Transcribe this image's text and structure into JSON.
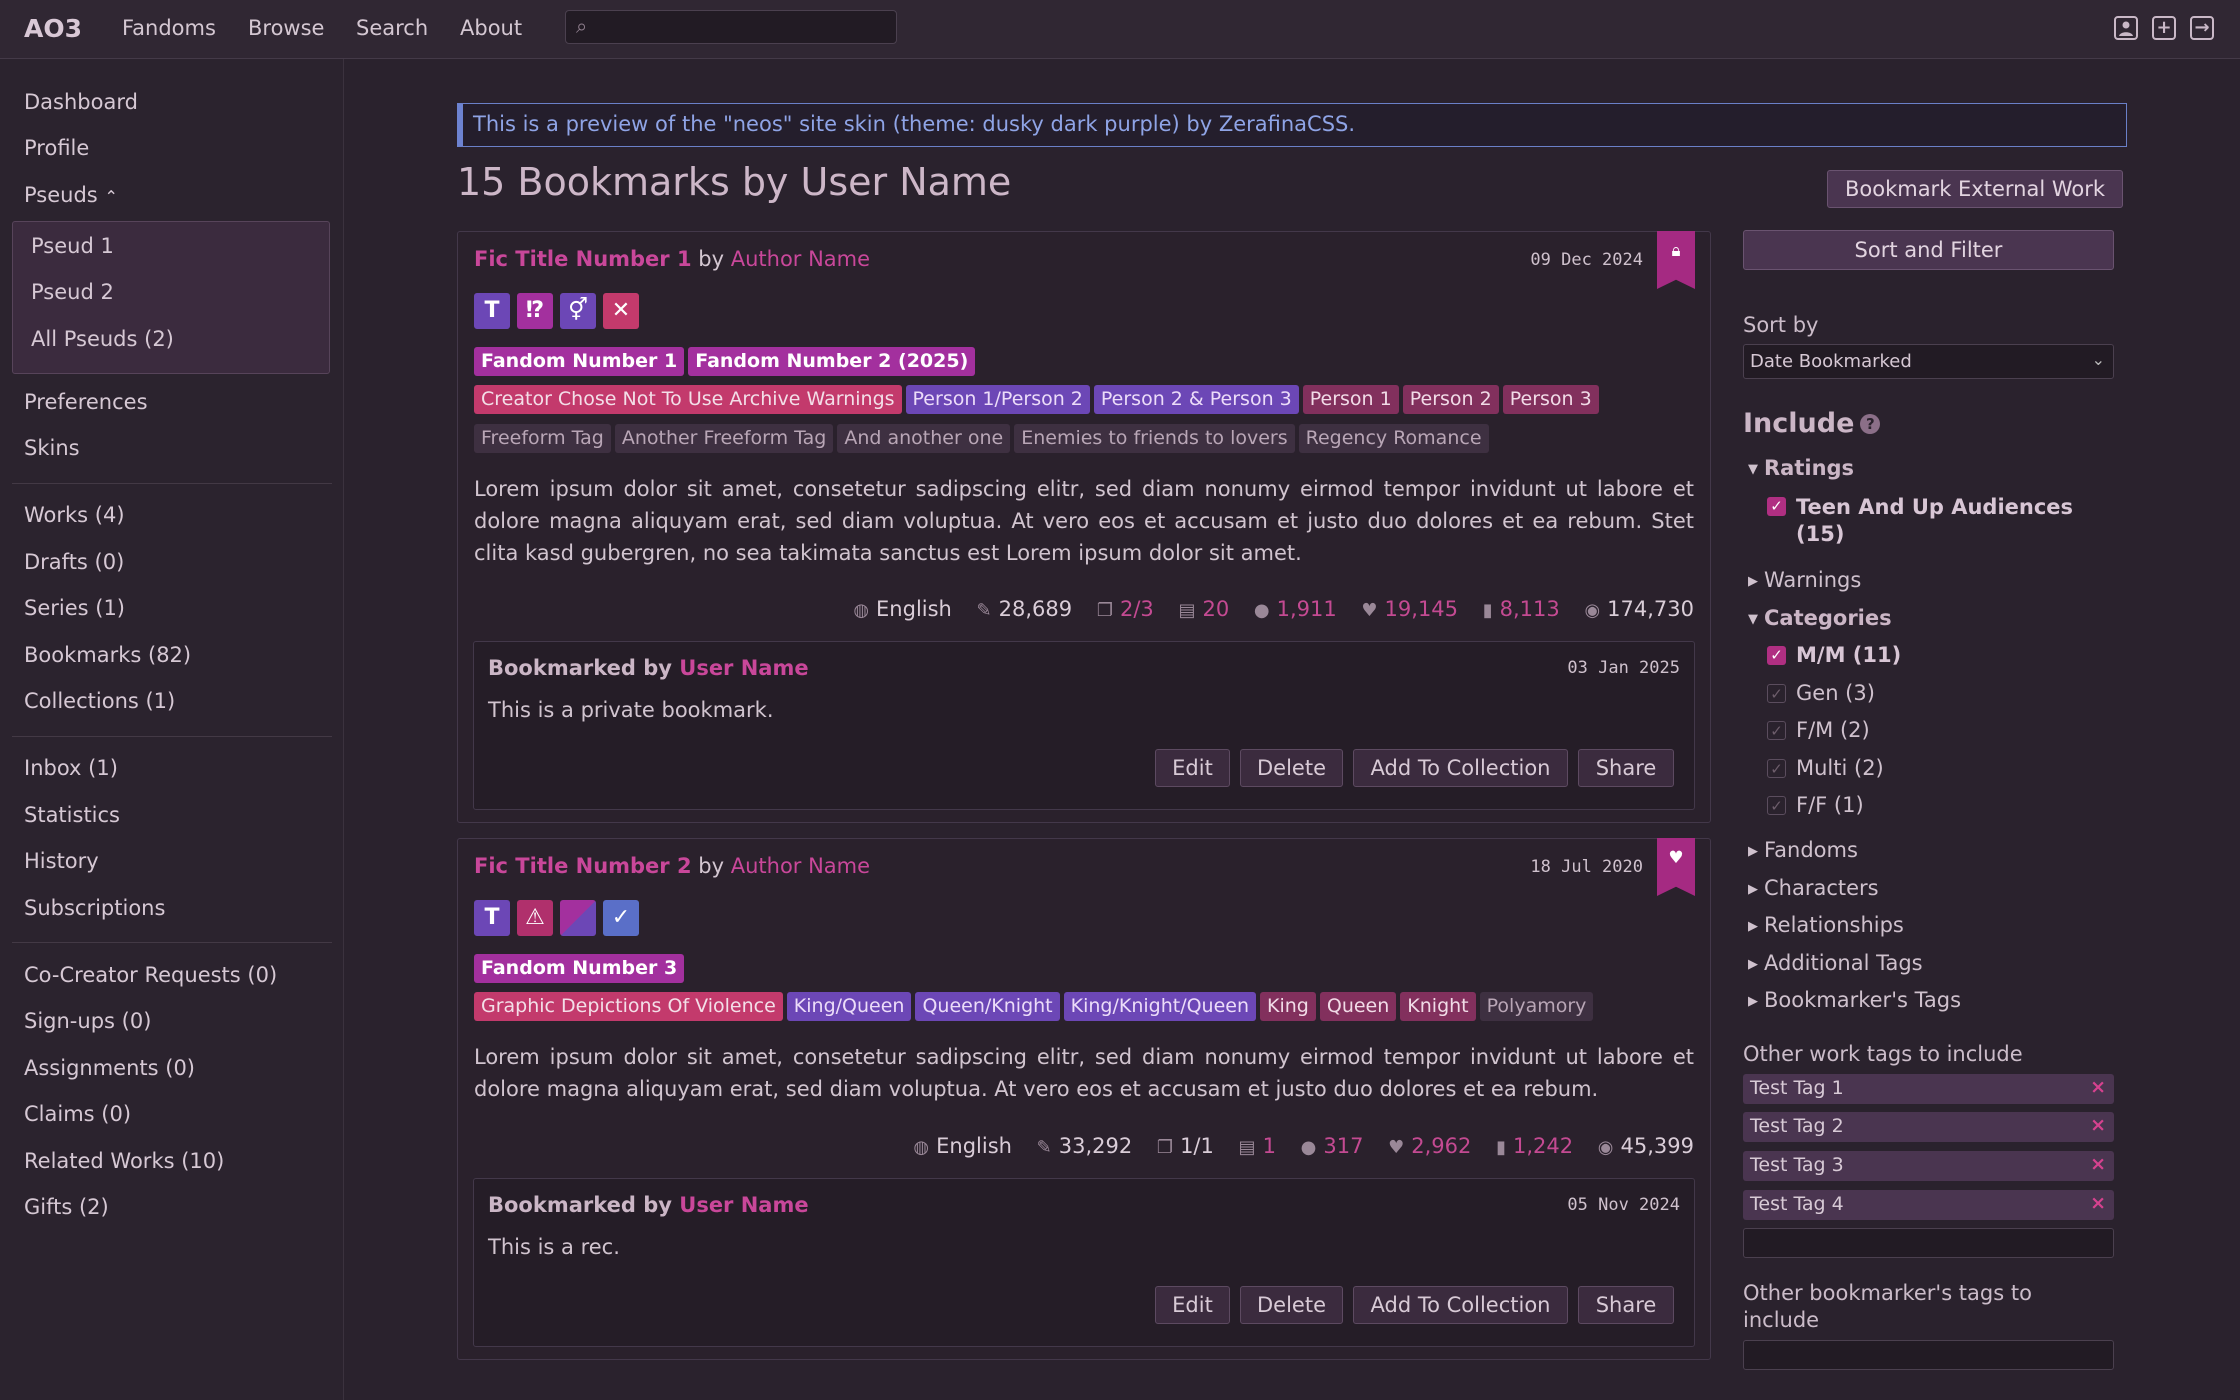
{
  "topbar": {
    "logo": "AO3",
    "nav": [
      "Fandoms",
      "Browse",
      "Search",
      "About"
    ],
    "search_value": "",
    "icons": [
      "user-icon",
      "add-icon",
      "logout-icon"
    ]
  },
  "sidebar": {
    "items": [
      "Dashboard",
      "Profile"
    ],
    "pseuds_label": "Pseuds",
    "pseuds": [
      "Pseud 1",
      "Pseud 2",
      "All Pseuds (2)"
    ],
    "items2": [
      "Preferences",
      "Skins"
    ],
    "items3": [
      "Works (4)",
      "Drafts (0)",
      "Series (1)",
      "Bookmarks (82)",
      "Collections (1)"
    ],
    "items4": [
      "Inbox (1)",
      "Statistics",
      "History",
      "Subscriptions"
    ],
    "items5": [
      "Co-Creator Requests (0)",
      "Sign-ups (0)",
      "Assignments (0)",
      "Claims (0)",
      "Related Works (10)",
      "Gifts (2)"
    ]
  },
  "banner": "This is a preview of the \"neos\" site skin (theme: dusky dark purple) by ZerafinaCSS.",
  "page_title": "15 Bookmarks by User Name",
  "bookmark_external": "Bookmark External Work",
  "works": [
    {
      "title": "Fic Title Number 1",
      "by": "by",
      "author": "Author Name",
      "date": "09 Dec 2024",
      "ribbon_icon": "lock-icon",
      "squares": [
        "T",
        "⁉",
        "⚥",
        "✕"
      ],
      "fandoms": [
        "Fandom Number 1",
        "Fandom Number 2 (2025)"
      ],
      "warnings": [
        "Creator Chose Not To Use Archive Warnings"
      ],
      "relationships": [
        "Person 1/Person 2",
        "Person 2 & Person 3"
      ],
      "characters": [
        "Person 1",
        "Person 2",
        "Person 3"
      ],
      "freeforms": [
        "Freeform Tag",
        "Another Freeform Tag",
        "And another one",
        "Enemies to friends to lovers",
        "Regency Romance"
      ],
      "summary": "Lorem ipsum dolor sit amet, consetetur sadipscing elitr, sed diam nonumy eirmod tempor invidunt ut labore et dolore magna aliquyam erat, sed diam voluptua. At vero eos et accusam et justo duo dolores et ea rebum. Stet clita kasd gubergren, no sea takimata sanctus est Lorem ipsum dolor sit amet.",
      "stats": {
        "language": "English",
        "words": "28,689",
        "chapters": "2/3",
        "collections": "20",
        "comments": "1,911",
        "kudos": "19,145",
        "bookmarks": "8,113",
        "hits": "174,730"
      },
      "bookmark": {
        "label": "Bookmarked by",
        "user": "User Name",
        "date": "03 Jan 2025",
        "note": "This is a private bookmark."
      }
    },
    {
      "title": "Fic Title Number 2",
      "by": "by",
      "author": "Author Name",
      "date": "18 Jul 2020",
      "ribbon_icon": "heart-icon",
      "squares": [
        "T",
        "⚠",
        "",
        "✓"
      ],
      "fandoms": [
        "Fandom Number 3"
      ],
      "warnings": [
        "Graphic Depictions Of Violence"
      ],
      "relationships": [
        "King/Queen",
        "Queen/Knight",
        "King/Knight/Queen"
      ],
      "characters": [
        "King",
        "Queen",
        "Knight"
      ],
      "freeforms": [
        "Polyamory"
      ],
      "summary": "Lorem ipsum dolor sit amet, consetetur sadipscing elitr, sed diam nonumy eirmod tempor invidunt ut labore et dolore magna aliquyam erat, sed diam voluptua. At vero eos et accusam et justo duo dolores et ea rebum.",
      "stats": {
        "language": "English",
        "words": "33,292",
        "chapters": "1/1",
        "collections": "1",
        "comments": "317",
        "kudos": "2,962",
        "bookmarks": "1,242",
        "hits": "45,399"
      },
      "bookmark": {
        "label": "Bookmarked by",
        "user": "User Name",
        "date": "05 Nov 2024",
        "note": "This is a rec."
      }
    }
  ],
  "actions": [
    "Edit",
    "Delete",
    "Add To Collection",
    "Share"
  ],
  "filter": {
    "button": "Sort and Filter",
    "sort_label": "Sort by",
    "sort_value": "Date Bookmarked",
    "include": "Include",
    "ratings": "Ratings",
    "ratings_items": [
      {
        "label": "Teen And Up Audiences",
        "count": "(15)",
        "checked": true
      }
    ],
    "warnings": "Warnings",
    "categories": "Categories",
    "category_items": [
      {
        "label": "M/M (11)",
        "checked": true
      },
      {
        "label": "Gen (3)",
        "checked": false
      },
      {
        "label": "F/M (2)",
        "checked": false
      },
      {
        "label": "Multi (2)",
        "checked": false
      },
      {
        "label": "F/F (1)",
        "checked": false
      }
    ],
    "groups": [
      "Fandoms",
      "Characters",
      "Relationships",
      "Additional Tags",
      "Bookmarker's Tags"
    ],
    "other_work_tags": "Other work tags to include",
    "tags": [
      "Test Tag 1",
      "Test Tag 2",
      "Test Tag 3",
      "Test Tag 4"
    ],
    "other_bookmarker_tags": "Other bookmarker's tags to include"
  },
  "colors": {
    "accent": "#c9479a",
    "fandom": "#a3309e",
    "warning": "#c33a6c",
    "relationship": "#6c47b6",
    "character": "#82305d"
  }
}
